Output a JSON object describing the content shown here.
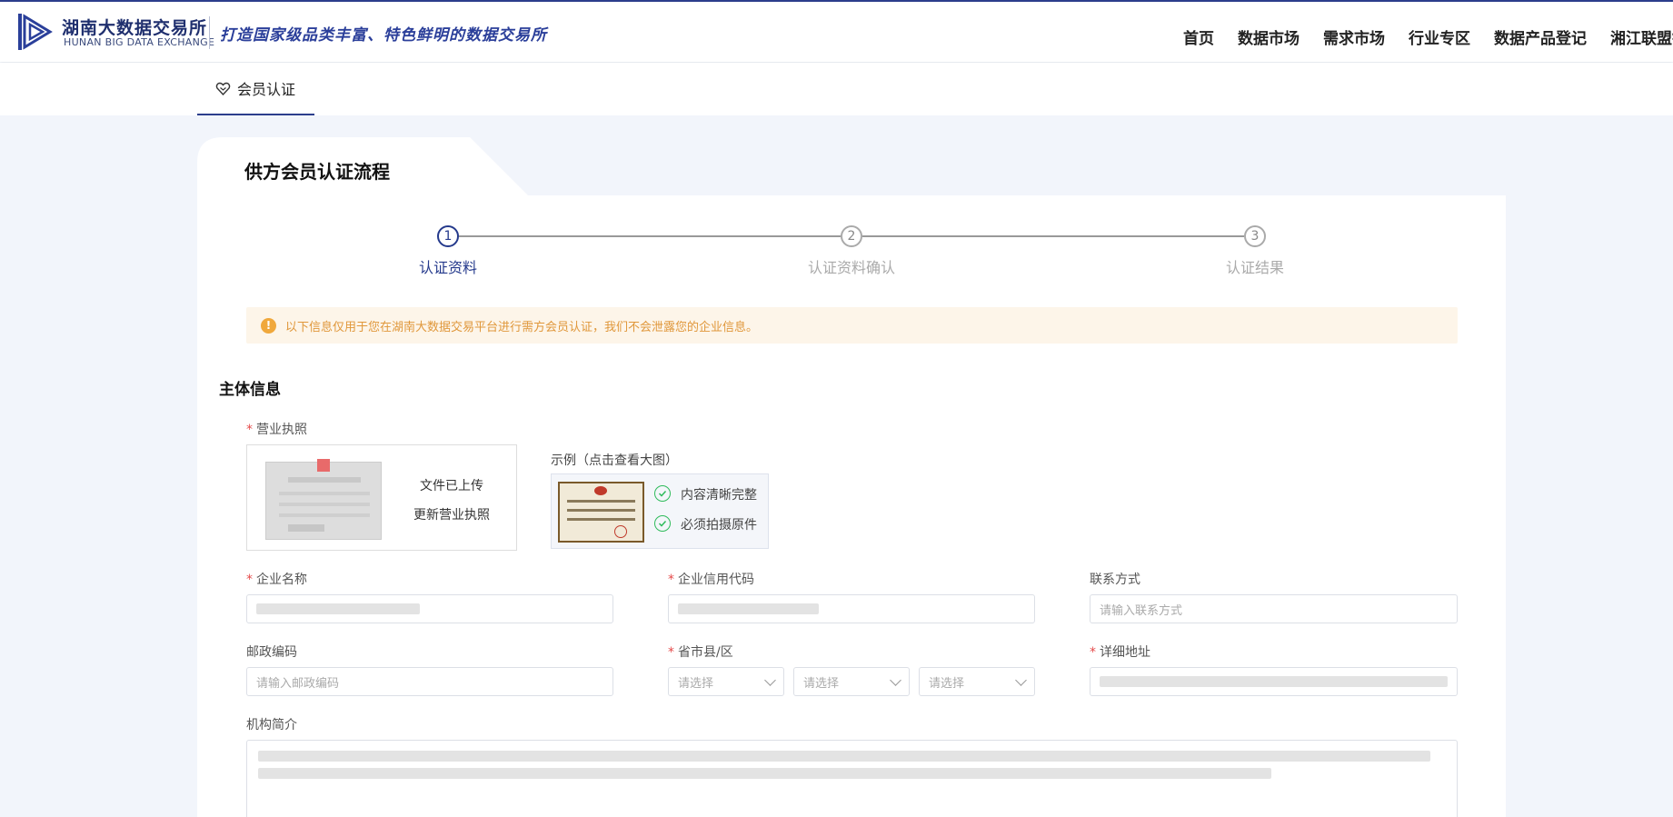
{
  "header": {
    "logo_cn": "湖南大数据交易所",
    "logo_en": "HUNAN BIG DATA EXCHANGE",
    "slogan": "打造国家级品类丰富、特色鲜明的数据交易所",
    "nav": [
      "首页",
      "数据市场",
      "需求市场",
      "行业专区",
      "数据产品登记",
      "湘江联盟链"
    ]
  },
  "subnav": {
    "tab_label": "会员认证"
  },
  "card": {
    "title": "供方会员认证流程",
    "steps": [
      {
        "num": "1",
        "label": "认证资料"
      },
      {
        "num": "2",
        "label": "认证资料确认"
      },
      {
        "num": "3",
        "label": "认证结果"
      }
    ],
    "active_step": 1,
    "alert_text": "以下信息仅用于您在湖南大数据交易平台进行需方会员认证，我们不会泄露您的企业信息。"
  },
  "form": {
    "section_title": "主体信息",
    "business_license": {
      "label": "营业执照",
      "status": "文件已上传",
      "update": "更新营业执照"
    },
    "example": {
      "label": "示例（点击查看大图）",
      "checks": [
        "内容清晰完整",
        "必须拍摄原件"
      ]
    },
    "company_name": {
      "label": "企业名称"
    },
    "credit_code": {
      "label": "企业信用代码"
    },
    "contact": {
      "label": "联系方式",
      "placeholder": "请输入联系方式"
    },
    "postal_code": {
      "label": "邮政编码",
      "placeholder": "请输入邮政编码"
    },
    "region": {
      "label": "省市县/区",
      "selects": [
        "请选择",
        "请选择",
        "请选择"
      ]
    },
    "address": {
      "label": "详细地址"
    },
    "intro": {
      "label": "机构简介"
    }
  },
  "colors": {
    "brand": "#253a8c",
    "alert_bg": "#fdf5e9",
    "alert_text": "#e0973a",
    "required": "#e54b4b"
  }
}
